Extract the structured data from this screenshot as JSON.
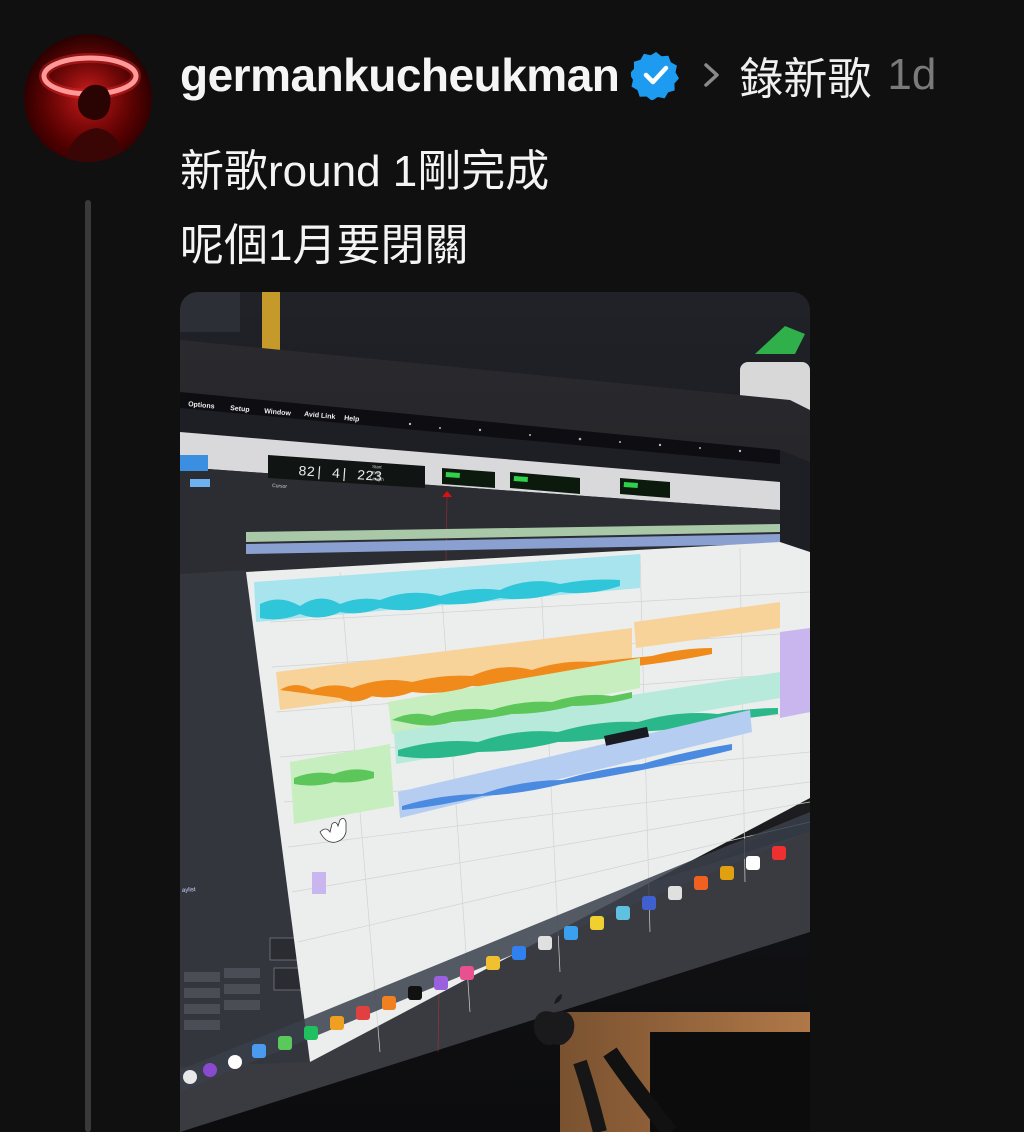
{
  "post": {
    "username": "germankucheukman",
    "topic": "錄新歌",
    "time": "1d",
    "lines": [
      "新歌round 1剛完成",
      "呢個1月要閉關"
    ]
  },
  "screen": {
    "menu": [
      "Options",
      "Setup",
      "Window",
      "Avid Link",
      "Help"
    ],
    "counter": "82| 4| 223",
    "cursor_label": "Cursor",
    "start_label": "Start",
    "end_label": "End",
    "length_label": "Length",
    "playlist_label": "aylist"
  },
  "colors": {
    "verified": "#1d9bf0",
    "accent_red": "#e01010",
    "clip_cyan": "#7fd8e6",
    "clip_orange": "#f0a33a",
    "clip_green": "#8ee08a",
    "clip_blue": "#8fb4e8"
  }
}
